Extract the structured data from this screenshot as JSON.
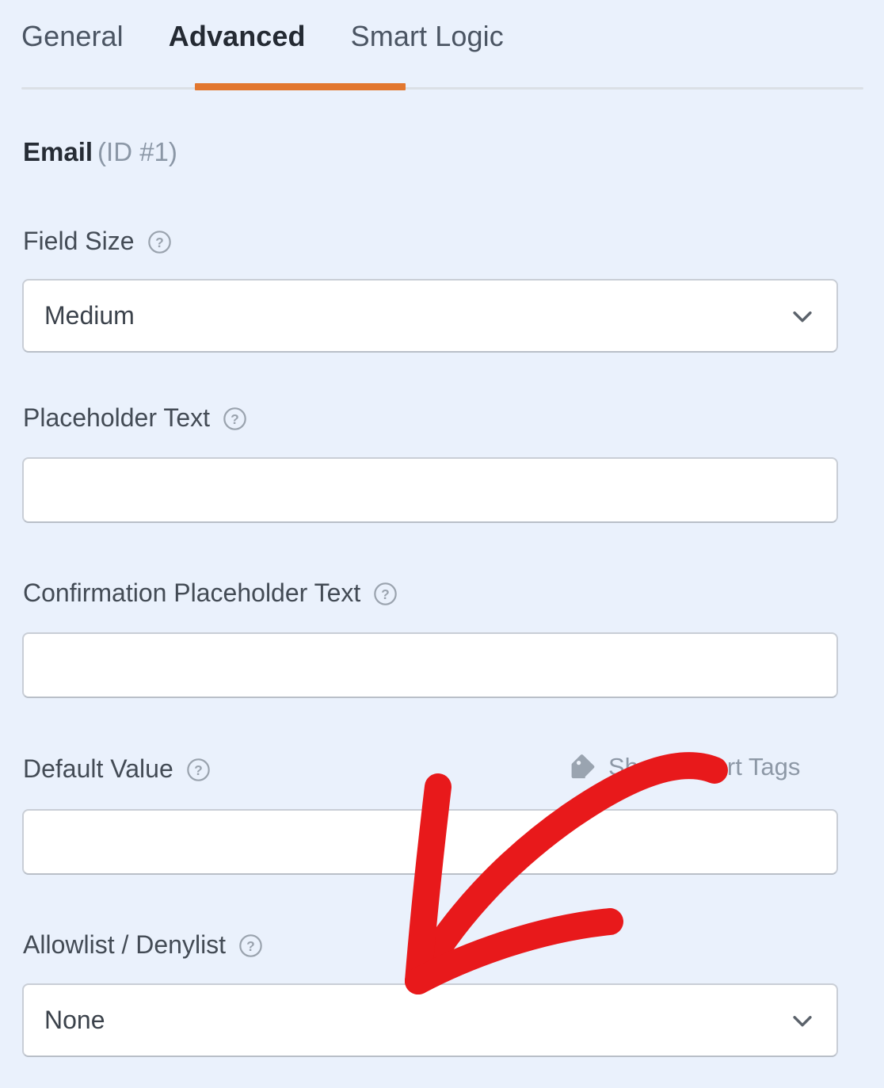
{
  "tabs": [
    {
      "label": "General",
      "active": false
    },
    {
      "label": "Advanced",
      "active": true
    },
    {
      "label": "Smart Logic",
      "active": false
    }
  ],
  "field_heading": {
    "name": "Email",
    "id": "(ID #1)"
  },
  "fields": {
    "field_size": {
      "label": "Field Size",
      "help": "?",
      "value": "Medium"
    },
    "placeholder_text": {
      "label": "Placeholder Text",
      "help": "?",
      "value": "",
      "placeholder": ""
    },
    "confirmation_placeholder_text": {
      "label": "Confirmation Placeholder Text",
      "help": "?",
      "value": "",
      "placeholder": ""
    },
    "default_value": {
      "label": "Default Value",
      "help": "?",
      "value": "",
      "placeholder": "",
      "smart_tags_label": "Show Smart Tags",
      "smart_tags_icon": "tag-icon"
    },
    "allowlist_denylist": {
      "label": "Allowlist / Denylist",
      "help": "?",
      "value": "None"
    }
  },
  "icons": {
    "help": "question-mark-circle-icon",
    "chevron": "chevron-down-icon",
    "tag": "tag-icon",
    "annotation": "red-arrow-annotation"
  },
  "colors": {
    "background": "#eaf1fc",
    "accent_orange": "#e2772f",
    "annotation_red": "#e8191b",
    "text_primary": "#3b424b",
    "text_muted": "#8d98a6",
    "border": "#c9ced6"
  }
}
